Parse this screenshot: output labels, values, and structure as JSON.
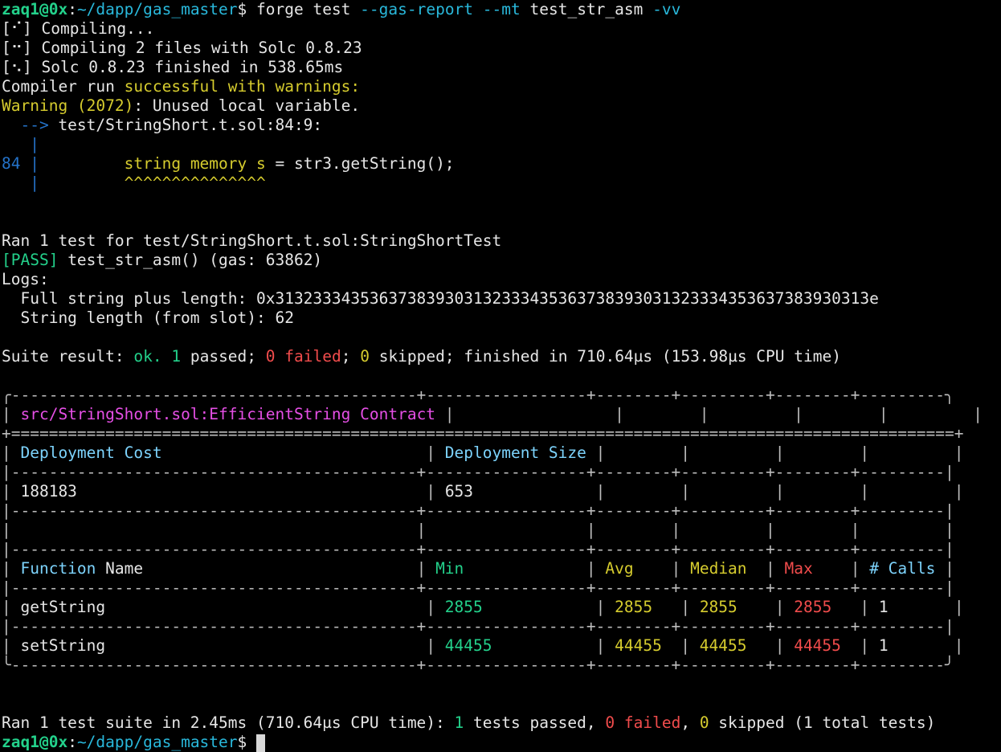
{
  "prompt": {
    "user_host": "zaq1@0x",
    "sep": ":",
    "path": "~/dapp/gas_master",
    "dollar": "$ ",
    "command": "forge test --gas-report --mt test_str_asm -vv"
  },
  "compile": {
    "l1_bracket": "[⠊]",
    "l1_text": " Compiling...",
    "l2_bracket": "[⠒]",
    "l2_text": " Compiling 2 files with Solc 0.8.23",
    "l3_bracket": "[⠢]",
    "l3_text": " Solc 0.8.23 finished in 538.65ms",
    "run_prefix": "Compiler run ",
    "run_status": "successful with warnings:",
    "warning_label": "Warning (2072)",
    "warning_msg": ": Unused local variable.",
    "arrow": "  -->",
    "location": " test/StringShort.t.sol:84:9:",
    "gutter_pipe": "   |",
    "line_no": "84",
    "code_pipe": " |",
    "code_indent": "         ",
    "code_highlight": "string memory s",
    "code_rest": " = str3.getString();",
    "underline": "^^^^^^^^^^^^^^^"
  },
  "results": {
    "ran_line": "Ran 1 test for test/StringShort.t.sol:StringShortTest",
    "pass_tag": "[PASS]",
    "pass_text": " test_str_asm() (gas: 63862)",
    "logs_label": "Logs:",
    "log1": "  Full string plus length: 0x31323334353637383930313233343536373839303132333435363738393031 3e",
    "log1_clean": "  Full string plus length: 0x313233343536373839303132333435363738393031323334353637383930313e",
    "log2": "  String length (from slot): 62",
    "suite_prefix": "Suite result: ",
    "suite_ok": "ok.",
    "suite_sp1": " ",
    "suite_passed_n": "1",
    "suite_passed": " passed; ",
    "suite_failed_n": "0",
    "suite_failed": " failed",
    "suite_sep": "; ",
    "suite_skipped_n": "0",
    "suite_rest": " skipped; finished in 710.64µs (153.98µs CPU time)"
  },
  "table": {
    "top_border": "╭-------------------------------------------+-----------------+--------+---------+--------+---------╮",
    "sep_double": "+====================================================================================================+",
    "sep_dash": "|-------------------------------------------+-----------------+--------+---------+--------+---------|",
    "bottom_border": "╰-------------------------------------------+-----------------+--------+---------+--------+---------╯",
    "contract": "src/StringShort.sol:EfficientString Contract",
    "deploy_cost_label": "Deployment Cost",
    "deploy_size_label": "Deployment Size",
    "deploy_cost": "188183",
    "deploy_size": "653",
    "h_function": "Function",
    "h_name": " Name",
    "h_min": "Min",
    "h_avg": "Avg",
    "h_median": "Median",
    "h_max": "Max",
    "h_calls": "# Calls",
    "rows": [
      {
        "name": "getString",
        "min": "2855",
        "avg": "2855",
        "median": "2855",
        "max": "2855",
        "calls": "1"
      },
      {
        "name": "setString",
        "min": "44455",
        "avg": "44455",
        "median": "44455",
        "max": "44455",
        "calls": "1"
      }
    ]
  },
  "summary": {
    "prefix": "Ran 1 test suite in 2.45ms (710.64µs CPU time): ",
    "passed_n": "1",
    "passed": " tests passed, ",
    "failed_n": "0",
    "failed": " failed",
    "sep": ", ",
    "skipped_n": "0",
    "rest": " skipped (1 total tests)"
  },
  "colors": {
    "background": "#000000",
    "green": "#23d18b",
    "yellow": "#e5e510",
    "cyan": "#29b8db",
    "blue": "#2472c8",
    "red": "#f14c4c",
    "magenta": "#e54fe5"
  }
}
